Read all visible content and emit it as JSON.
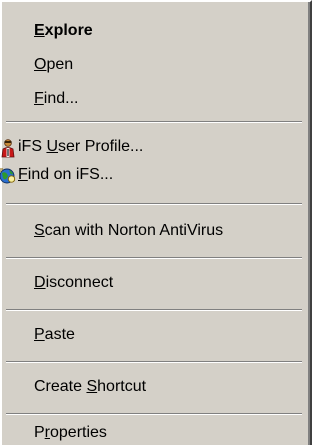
{
  "context_menu": {
    "items": [
      {
        "pre": "",
        "key": "E",
        "post": "xplore"
      },
      {
        "pre": "",
        "key": "O",
        "post": "pen"
      },
      {
        "pre": "",
        "key": "F",
        "post": "ind..."
      },
      {
        "pre": "iFS ",
        "key": "U",
        "post": "ser Profile...",
        "icon": "user-profile-icon"
      },
      {
        "pre": "",
        "key": "F",
        "post": "ind on iFS...",
        "icon": "find-globe-icon"
      },
      {
        "pre": "",
        "key": "S",
        "post": "can with Norton AntiVirus"
      },
      {
        "pre": "",
        "key": "D",
        "post": "isconnect"
      },
      {
        "pre": "",
        "key": "P",
        "post": "aste"
      },
      {
        "pre": "Create ",
        "key": "S",
        "post": "hortcut"
      },
      {
        "pre": "P",
        "key": "r",
        "post": "operties"
      }
    ]
  },
  "colors": {
    "menu_bg": "#d4d0c8",
    "separator_dark": "#808080",
    "separator_light": "#ffffff",
    "text": "#000000"
  }
}
